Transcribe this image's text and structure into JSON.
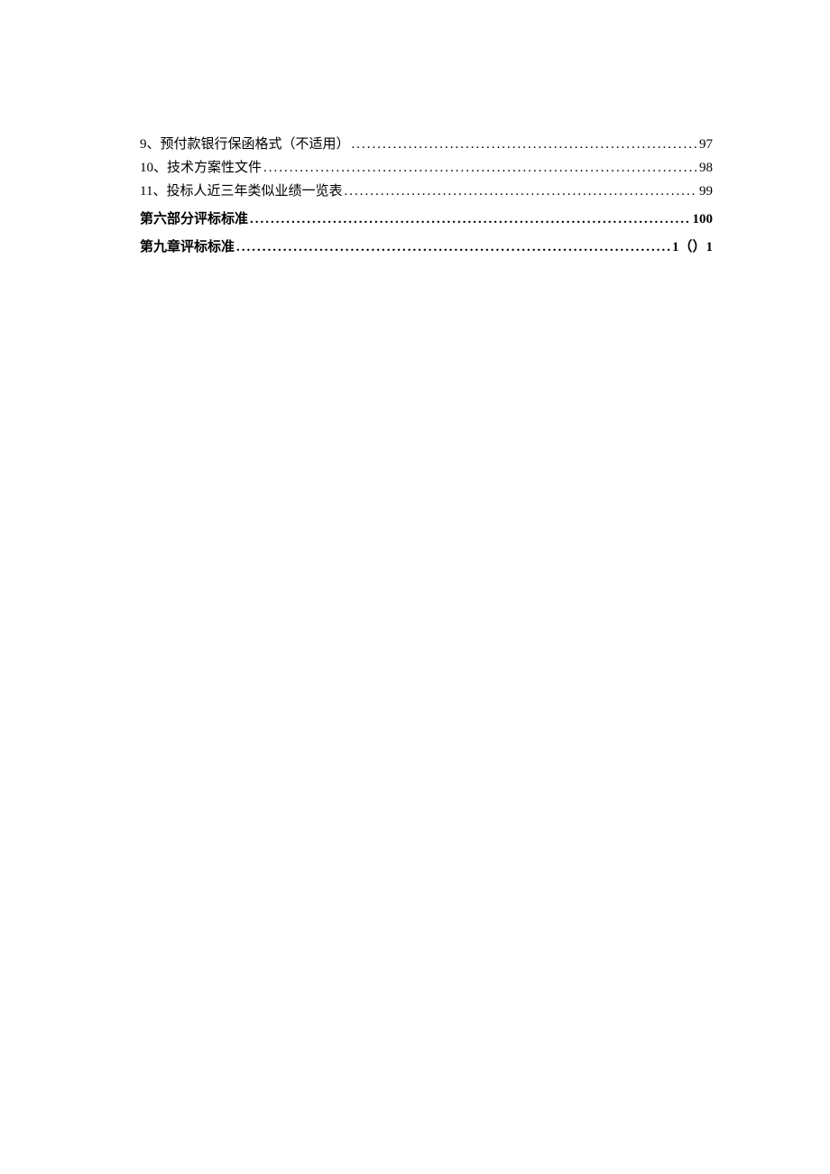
{
  "toc": {
    "items": [
      {
        "label": "9、预付款银行保函格式（不适用）",
        "page": "97",
        "bold": false
      },
      {
        "label": "10、技术方案性文件",
        "page": "98",
        "bold": false
      },
      {
        "label": "11、投标人近三年类似业绩一览表",
        "page": "99",
        "bold": false
      }
    ],
    "sections": [
      {
        "label": "第六部分评标标准",
        "page": "100",
        "bold": true
      },
      {
        "label": "第九章评标标准",
        "page": "1（）1",
        "bold": true
      }
    ]
  }
}
